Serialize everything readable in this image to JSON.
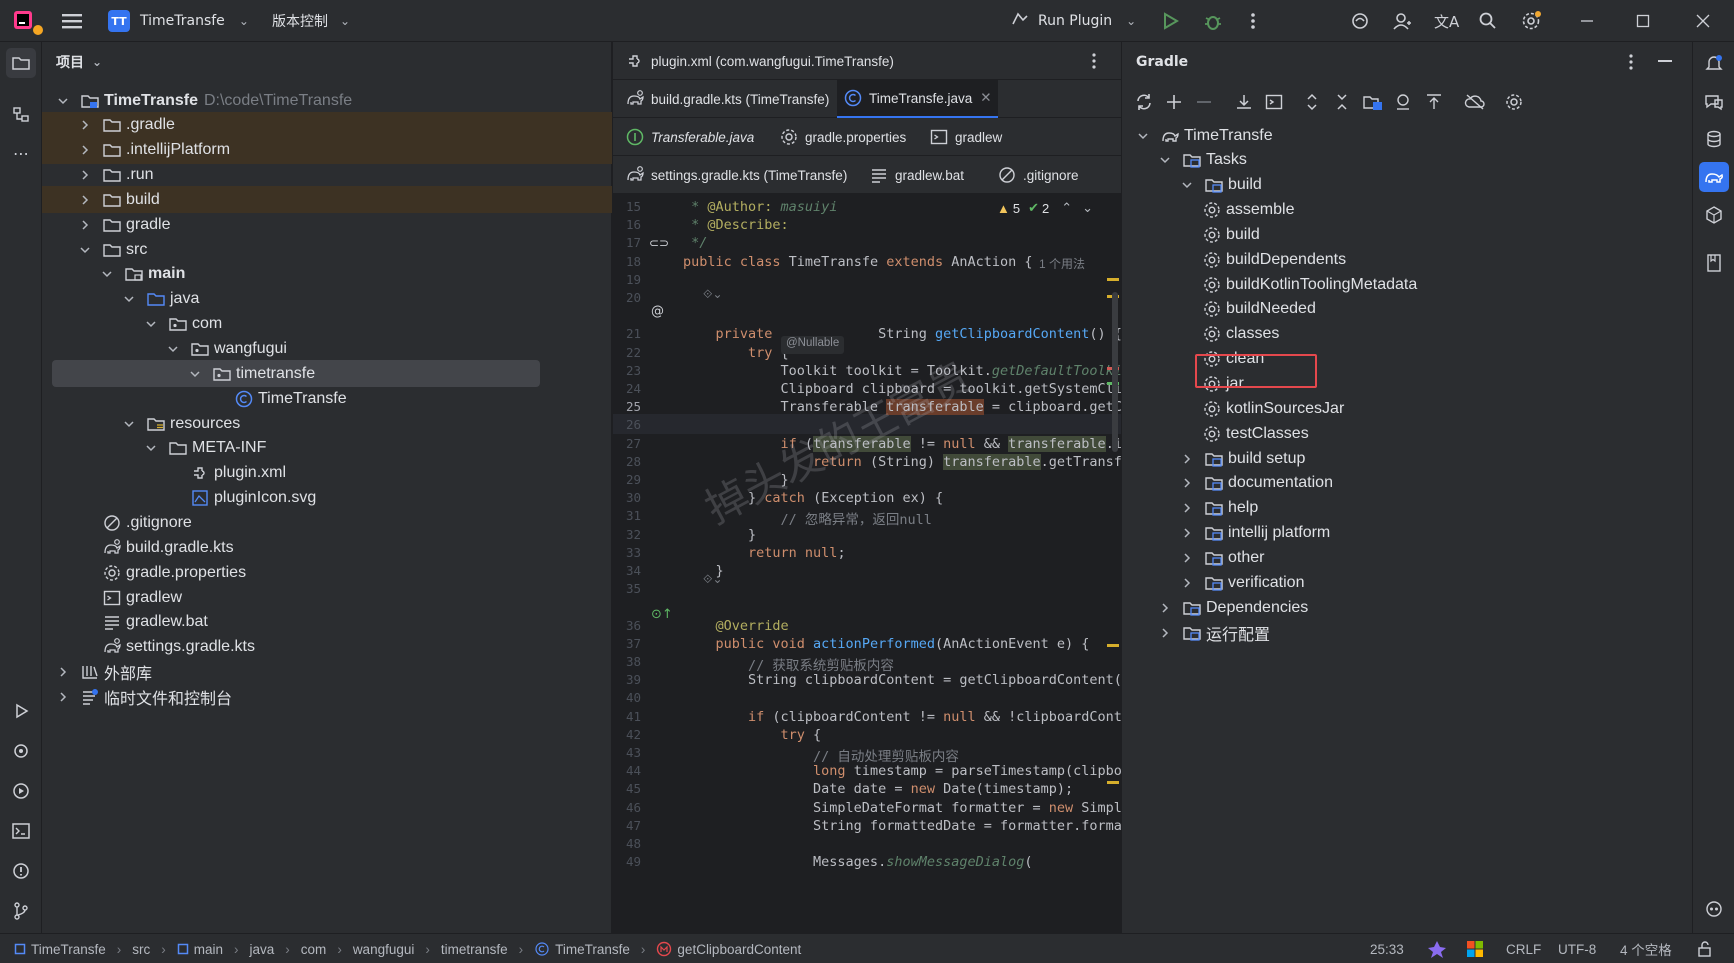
{
  "titlebar": {
    "project_badge": "TT",
    "project_name": "TimeTransfe",
    "vcs_label": "版本控制",
    "run_config": "Run Plugin"
  },
  "project_panel": {
    "header": "项目",
    "tree": [
      {
        "label": "TimeTransfe",
        "extra": "D:\\code\\TimeTransfe",
        "depth": 0,
        "icon": "module-folder-icon",
        "expanded": true,
        "bold": true
      },
      {
        "label": ".gradle",
        "depth": 1,
        "icon": "folder-icon",
        "expanded": false,
        "excluded": true
      },
      {
        "label": ".intellijPlatform",
        "depth": 1,
        "icon": "folder-icon",
        "expanded": false,
        "excluded": true
      },
      {
        "label": ".run",
        "depth": 1,
        "icon": "folder-icon",
        "expanded": false
      },
      {
        "label": "build",
        "depth": 1,
        "icon": "folder-icon",
        "expanded": false,
        "excluded": true
      },
      {
        "label": "gradle",
        "depth": 1,
        "icon": "folder-icon",
        "expanded": false
      },
      {
        "label": "src",
        "depth": 1,
        "icon": "folder-icon",
        "expanded": true
      },
      {
        "label": "main",
        "depth": 2,
        "icon": "source-folder-icon",
        "expanded": true,
        "bold": true
      },
      {
        "label": "java",
        "depth": 3,
        "icon": "java-folder-icon",
        "expanded": true
      },
      {
        "label": "com",
        "depth": 4,
        "icon": "package-icon",
        "expanded": true
      },
      {
        "label": "wangfugui",
        "depth": 5,
        "icon": "package-icon",
        "expanded": true
      },
      {
        "label": "timetransfe",
        "depth": 6,
        "icon": "package-icon",
        "expanded": true,
        "selected": true
      },
      {
        "label": "TimeTransfe",
        "depth": 7,
        "icon": "class-icon",
        "leaf": true
      },
      {
        "label": "resources",
        "depth": 3,
        "icon": "resources-folder-icon",
        "expanded": true
      },
      {
        "label": "META-INF",
        "depth": 4,
        "icon": "folder-icon",
        "expanded": true
      },
      {
        "label": "plugin.xml",
        "depth": 5,
        "icon": "plugin-xml-icon",
        "leaf": true
      },
      {
        "label": "pluginIcon.svg",
        "depth": 5,
        "icon": "svg-file-icon",
        "leaf": true
      },
      {
        "label": ".gitignore",
        "depth": 1,
        "icon": "gitignore-icon",
        "leaf": true
      },
      {
        "label": "build.gradle.kts",
        "depth": 1,
        "icon": "gradle-file-icon",
        "leaf": true
      },
      {
        "label": "gradle.properties",
        "depth": 1,
        "icon": "properties-icon",
        "leaf": true
      },
      {
        "label": "gradlew",
        "depth": 1,
        "icon": "shell-icon",
        "leaf": true
      },
      {
        "label": "gradlew.bat",
        "depth": 1,
        "icon": "text-file-icon",
        "leaf": true
      },
      {
        "label": "settings.gradle.kts",
        "depth": 1,
        "icon": "gradle-file-icon",
        "leaf": true
      },
      {
        "label": "外部库",
        "depth": 0,
        "icon": "library-icon",
        "expanded": false
      },
      {
        "label": "临时文件和控制台",
        "depth": 0,
        "icon": "scratch-icon",
        "expanded": false
      }
    ]
  },
  "editor": {
    "tab_rows": [
      [
        {
          "label": "plugin.xml (com.wangfugui.TimeTransfe)",
          "icon": "plugin-xml-icon"
        }
      ],
      [
        {
          "label": "build.gradle.kts (TimeTransfe)",
          "icon": "gradle-file-icon"
        },
        {
          "label": "TimeTransfe.java",
          "icon": "class-icon",
          "active": true,
          "closable": true
        }
      ],
      [
        {
          "label": "Transferable.java",
          "icon": "interface-icon",
          "italic": true
        },
        {
          "label": "gradle.properties",
          "icon": "properties-icon"
        },
        {
          "label": "gradlew",
          "icon": "shell-icon"
        }
      ],
      [
        {
          "label": "settings.gradle.kts (TimeTransfe)",
          "icon": "gradle-file-icon"
        },
        {
          "label": "gradlew.bat",
          "icon": "text-file-icon"
        },
        {
          "label": ".gitignore",
          "icon": "gitignore-icon"
        }
      ]
    ],
    "inspection": {
      "warnings": "5",
      "weak_warnings": "2"
    },
    "usage_hint": "1 个用法",
    "nullable_hint": "@Nullable",
    "lines": [
      {
        "n": "15",
        "segs": [
          [
            "doc",
            " * "
          ],
          [
            "ann",
            "@Author:"
          ],
          [
            "doc",
            " masuiyi"
          ]
        ]
      },
      {
        "n": "16",
        "segs": [
          [
            "doc",
            " * "
          ],
          [
            "ann",
            "@Describe:"
          ]
        ]
      },
      {
        "n": "17",
        "segs": [
          [
            "doc",
            " */"
          ]
        ]
      },
      {
        "n": "18",
        "segs": [
          [
            "kw",
            "public class "
          ],
          [
            "",
            "TimeTransfe "
          ],
          [
            "kw",
            "extends "
          ],
          [
            "",
            "AnAction {"
          ]
        ]
      },
      {
        "n": "19",
        "segs": []
      },
      {
        "n": "20",
        "segs": []
      },
      {
        "n": "",
        "segs": []
      },
      {
        "n": "21",
        "segs": [
          [
            "kw",
            "    private "
          ],
          [
            "",
            "            String "
          ],
          [
            "fn",
            "getClipboardContent"
          ],
          [
            "",
            "() {"
          ]
        ]
      },
      {
        "n": "22",
        "segs": [
          [
            "kw",
            "        try "
          ],
          [
            "",
            "{"
          ]
        ]
      },
      {
        "n": "23",
        "segs": [
          [
            "",
            "            Toolkit toolkit = Toolkit."
          ],
          [
            "doc",
            "getDefaultToolkit"
          ]
        ]
      },
      {
        "n": "24",
        "segs": [
          [
            "",
            "            Clipboard clipboard = toolkit.getSystemClip"
          ]
        ]
      },
      {
        "n": "25",
        "segs": [
          [
            "",
            "            Transferable "
          ],
          [
            "hlr",
            "transferable"
          ],
          [
            "",
            " = clipboard.getCo"
          ]
        ]
      },
      {
        "n": "26",
        "segs": []
      },
      {
        "n": "27",
        "segs": [
          [
            "kw",
            "            if "
          ],
          [
            "",
            "("
          ],
          [
            "hlv",
            "transferable"
          ],
          [
            "",
            " != "
          ],
          [
            "kw",
            "null "
          ],
          [
            "",
            "&& "
          ],
          [
            "hlv",
            "transferable"
          ],
          [
            "",
            ".is"
          ]
        ]
      },
      {
        "n": "28",
        "segs": [
          [
            "kw",
            "                return "
          ],
          [
            "",
            "(String) "
          ],
          [
            "hlv",
            "transferable"
          ],
          [
            "",
            ".getTransfe"
          ]
        ]
      },
      {
        "n": "29",
        "segs": [
          [
            "",
            "            }"
          ]
        ]
      },
      {
        "n": "30",
        "segs": [
          [
            "",
            "        } "
          ],
          [
            "kw",
            "catch "
          ],
          [
            "",
            "(Exception ex) {"
          ]
        ]
      },
      {
        "n": "31",
        "segs": [
          [
            "cm",
            "            // 忽略异常，返回null"
          ]
        ]
      },
      {
        "n": "32",
        "segs": [
          [
            "",
            "        }"
          ]
        ]
      },
      {
        "n": "33",
        "segs": [
          [
            "kw",
            "        return null"
          ],
          [
            "",
            ";"
          ]
        ]
      },
      {
        "n": "34",
        "segs": [
          [
            "",
            "    }"
          ]
        ]
      },
      {
        "n": "35",
        "segs": []
      },
      {
        "n": "",
        "segs": []
      },
      {
        "n": "36",
        "segs": [
          [
            "ann",
            "    @Override"
          ]
        ]
      },
      {
        "n": "37",
        "segs": [
          [
            "kw",
            "    public void "
          ],
          [
            "fn",
            "actionPerformed"
          ],
          [
            "",
            "(AnActionEvent e) {"
          ]
        ]
      },
      {
        "n": "38",
        "segs": [
          [
            "cm",
            "        // 获取系统剪贴板内容"
          ]
        ]
      },
      {
        "n": "39",
        "segs": [
          [
            "",
            "        String clipboardContent = getClipboardContent()"
          ]
        ]
      },
      {
        "n": "40",
        "segs": []
      },
      {
        "n": "41",
        "segs": [
          [
            "kw",
            "        if "
          ],
          [
            "",
            "(clipboardContent != "
          ],
          [
            "kw",
            "null "
          ],
          [
            "",
            "&& !clipboardConte"
          ]
        ]
      },
      {
        "n": "42",
        "segs": [
          [
            "kw",
            "            try "
          ],
          [
            "",
            "{"
          ]
        ]
      },
      {
        "n": "43",
        "segs": [
          [
            "cm",
            "                // 自动处理剪贴板内容"
          ]
        ]
      },
      {
        "n": "44",
        "segs": [
          [
            "kw",
            "                long "
          ],
          [
            "",
            "timestamp = parseTimestamp(clipboa"
          ]
        ]
      },
      {
        "n": "45",
        "segs": [
          [
            "",
            "                Date date = "
          ],
          [
            "kw",
            "new "
          ],
          [
            "",
            "Date(timestamp);"
          ]
        ]
      },
      {
        "n": "46",
        "segs": [
          [
            "",
            "                SimpleDateFormat formatter = "
          ],
          [
            "kw",
            "new "
          ],
          [
            "",
            "Simple"
          ]
        ]
      },
      {
        "n": "47",
        "segs": [
          [
            "",
            "                String formattedDate = formatter.format"
          ]
        ]
      },
      {
        "n": "48",
        "segs": []
      },
      {
        "n": "49",
        "segs": [
          [
            "",
            "                Messages."
          ],
          [
            "doc",
            "showMessageDialog"
          ],
          [
            "",
            "("
          ]
        ]
      }
    ],
    "watermark": "掉头发的王富贵"
  },
  "gradle_panel": {
    "title": "Gradle",
    "tree": [
      {
        "label": "TimeTransfe",
        "depth": 0,
        "icon": "gradle-elephant-icon",
        "expanded": true
      },
      {
        "label": "Tasks",
        "depth": 1,
        "icon": "task-folder-icon",
        "expanded": true
      },
      {
        "label": "build",
        "depth": 2,
        "icon": "task-folder-icon",
        "expanded": true
      },
      {
        "label": "assemble",
        "depth": 3,
        "icon": "gear-icon",
        "leaf": true
      },
      {
        "label": "build",
        "depth": 3,
        "icon": "gear-icon",
        "leaf": true
      },
      {
        "label": "buildDependents",
        "depth": 3,
        "icon": "gear-icon",
        "leaf": true
      },
      {
        "label": "buildKotlinToolingMetadata",
        "depth": 3,
        "icon": "gear-icon",
        "leaf": true
      },
      {
        "label": "buildNeeded",
        "depth": 3,
        "icon": "gear-icon",
        "leaf": true
      },
      {
        "label": "classes",
        "depth": 3,
        "icon": "gear-icon",
        "leaf": true
      },
      {
        "label": "clean",
        "depth": 3,
        "icon": "gear-icon",
        "leaf": true
      },
      {
        "label": "jar",
        "depth": 3,
        "icon": "gear-icon",
        "leaf": true,
        "highlighted": true
      },
      {
        "label": "kotlinSourcesJar",
        "depth": 3,
        "icon": "gear-icon",
        "leaf": true
      },
      {
        "label": "testClasses",
        "depth": 3,
        "icon": "gear-icon",
        "leaf": true
      },
      {
        "label": "build setup",
        "depth": 2,
        "icon": "task-folder-icon",
        "expanded": false
      },
      {
        "label": "documentation",
        "depth": 2,
        "icon": "task-folder-icon",
        "expanded": false
      },
      {
        "label": "help",
        "depth": 2,
        "icon": "task-folder-icon",
        "expanded": false
      },
      {
        "label": "intellij platform",
        "depth": 2,
        "icon": "task-folder-icon",
        "expanded": false
      },
      {
        "label": "other",
        "depth": 2,
        "icon": "task-folder-icon",
        "expanded": false
      },
      {
        "label": "verification",
        "depth": 2,
        "icon": "task-folder-icon",
        "expanded": false
      },
      {
        "label": "Dependencies",
        "depth": 1,
        "icon": "task-folder-icon",
        "expanded": false
      },
      {
        "label": "运行配置",
        "depth": 1,
        "icon": "task-folder-icon",
        "expanded": false
      }
    ]
  },
  "statusbar": {
    "breadcrumbs": [
      "TimeTransfe",
      "src",
      "main",
      "java",
      "com",
      "wangfugui",
      "timetransfe",
      "TimeTransfe",
      "getClipboardContent"
    ],
    "position": "25:33",
    "line_ending": "CRLF",
    "encoding": "UTF-8",
    "indent": "4 个空格"
  },
  "colors": {
    "accent": "#3574f0",
    "highlight_box": "#e5484d",
    "excluded_row": "#3d3223"
  }
}
